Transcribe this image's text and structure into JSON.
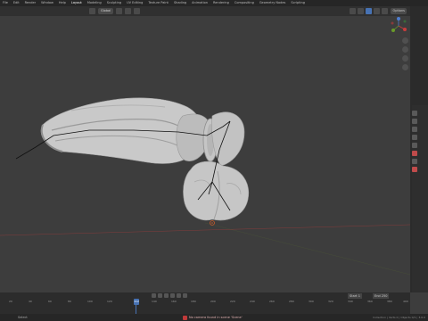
{
  "topbar": {
    "menu": [
      "File",
      "Edit",
      "Render",
      "Window",
      "Help",
      "Layout",
      "Modeling",
      "Sculpting",
      "UV Editing",
      "Texture Paint",
      "Shading",
      "Animation",
      "Rendering",
      "Compositing",
      "Geometry Nodes",
      "Scripting"
    ],
    "active_index": 5
  },
  "header": {
    "orientation_label": "Global",
    "options_label": "Options"
  },
  "timeline": {
    "frame_ticks": [
      "20",
      "40",
      "60",
      "80",
      "100",
      "120",
      "140",
      "160",
      "180",
      "200",
      "220",
      "240",
      "260",
      "280",
      "300",
      "320",
      "340",
      "360",
      "380",
      "400"
    ],
    "current_frame": "112",
    "start_label": "Start",
    "start_value": "1",
    "end_label": "End",
    "end_value": "250"
  },
  "status": {
    "left": "Select",
    "warning": "No camera found in scene 'Scene'",
    "right": "Collection | Verts 0 | Objects 0/1 | 3.6.0"
  },
  "colors": {
    "accent": "#4772b3",
    "axis_x": "#c83c3c",
    "axis_y": "#6a8a2a",
    "mesh": "#c9c9c9"
  }
}
